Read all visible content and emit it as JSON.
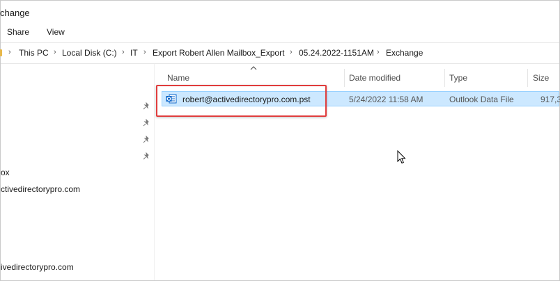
{
  "window": {
    "title_visible": "change"
  },
  "ribbon": {
    "tabs": [
      "Share",
      "View"
    ]
  },
  "address_bar": {
    "crumbs": [
      "This PC",
      "Local Disk (C:)",
      "IT",
      "Export Robert Allen Mailbox_Export",
      "05.24.2022-1151AM",
      "Exchange"
    ]
  },
  "nav_pane": {
    "items": [
      "ox",
      "ctivedirectorypro.com",
      "ivedirectorypro.com"
    ]
  },
  "file_list": {
    "columns": {
      "name": "Name",
      "date": "Date modified",
      "type": "Type",
      "size": "Size"
    },
    "rows": [
      {
        "name": "robert@activedirectorypro.com.pst",
        "date": "5/24/2022 11:58 AM",
        "type": "Outlook Data File",
        "size": "917,3"
      }
    ]
  },
  "colors": {
    "selection_bg": "#cce8ff",
    "selection_border": "#99d1ff",
    "highlight_border": "#e03c3c",
    "outlook_blue": "#0a64c8"
  },
  "icons": [
    "folder-icon",
    "pin-icon",
    "outlook-pst-icon",
    "sort-up-icon",
    "mouse-cursor-icon"
  ]
}
